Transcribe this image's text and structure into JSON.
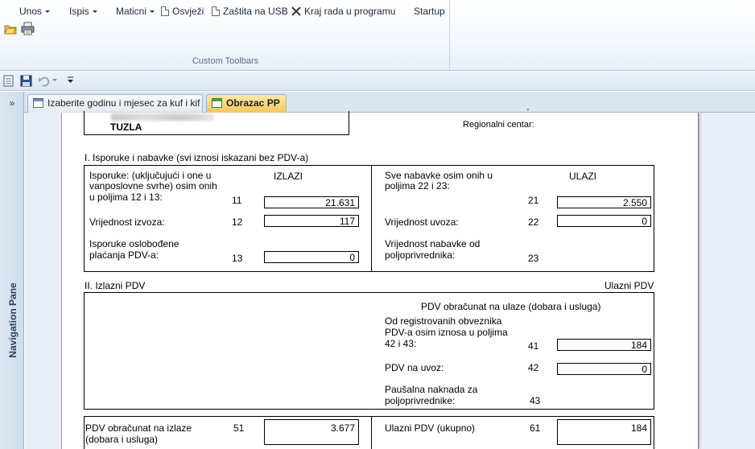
{
  "ribbon": {
    "menus": [
      {
        "label": "Unos",
        "has_dropdown": true
      },
      {
        "label": "Ispis",
        "has_dropdown": true
      },
      {
        "label": "Maticni",
        "has_dropdown": true
      }
    ],
    "commands": {
      "refresh": "Osvježi",
      "usb_protect": "Zaštita na USB",
      "exit": "Kraj rada u programu",
      "startup": "Startup"
    },
    "group_label": "Custom Toolbars"
  },
  "quick_access": {
    "icons": [
      "form-icon",
      "save-icon",
      "undo-icon",
      "customize-qat-icon"
    ]
  },
  "tabs": [
    {
      "label": "Izaberite godinu i mjesec za kuf i kif",
      "active": false
    },
    {
      "label": "Obrazac PP",
      "active": true
    }
  ],
  "nav_pane": {
    "toggle": "»",
    "label": "Navigation Pane"
  },
  "report": {
    "header": {
      "city": "TUZLA",
      "regional_center_label": "Regionalni centar:"
    },
    "section1": {
      "title": "I. Isporuke i nabavke (svi iznosi iskazani bez PDV-a)",
      "left_heading": "IZLAZI",
      "right_heading": "ULAZI",
      "left_rows": [
        {
          "label_lines": [
            "Isporuke: (uključujući i one u",
            "vanposlovne svrhe) osim onih",
            "u poljima 12 i 13:"
          ],
          "field": "11",
          "value": "21.631"
        },
        {
          "label_lines": [
            "Vrijednost izvoza:"
          ],
          "field": "12",
          "value": "117"
        },
        {
          "label_lines": [
            "Isporuke oslobođene",
            "plaćanja PDV-a:"
          ],
          "field": "13",
          "value": "0"
        }
      ],
      "right_rows": [
        {
          "label_lines": [
            "Sve nabavke osim onih u",
            "poljima 22 i 23:"
          ],
          "field": "21",
          "value": "2.550"
        },
        {
          "label_lines": [
            "Vrijednost uvoza:"
          ],
          "field": "22",
          "value": "0"
        },
        {
          "label_lines": [
            "Vrijednost nabavke od",
            "poljoprivrednika:"
          ],
          "field": "23",
          "value": ""
        }
      ]
    },
    "section2": {
      "title_left": "II. Izlazni PDV",
      "title_right": "Ulazni PDV",
      "subheading": "PDV obračunat na ulaze (dobara i usluga)",
      "rows": [
        {
          "label_lines": [
            "Od registrovanih obveznika",
            "PDV-a osim iznosa u poljima",
            "42 i 43:"
          ],
          "field": "41",
          "value": "184"
        },
        {
          "label_lines": [
            "PDV na uvoz:"
          ],
          "field": "42",
          "value": "0"
        },
        {
          "label_lines": [
            "Paušalna naknada za",
            "poljoprivrednike:"
          ],
          "field": "43",
          "value": ""
        }
      ],
      "totals": {
        "out_label_lines": [
          "PDV obračunat na izlaze",
          "(dobara i usluga)"
        ],
        "out_field": "51",
        "out_value": "3.677",
        "in_label": "Ulazni PDV (ukupno)",
        "in_field": "61",
        "in_value": "184"
      }
    }
  }
}
